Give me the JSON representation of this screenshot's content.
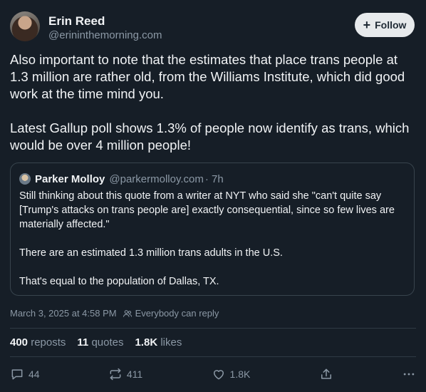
{
  "author": {
    "name": "Erin Reed",
    "handle": "@erininthemorning.com",
    "follow_label": "Follow"
  },
  "post": {
    "paragraphs": [
      "Also important to note that the estimates that place trans people at 1.3 million are rather old, from the Williams Institute, which did good work at the time mind you.",
      "Latest Gallup poll shows 1.3% of people now identify as trans, which would be over 4 million people!"
    ]
  },
  "quote": {
    "name": "Parker Molloy",
    "handle": "@parkermolloy.com",
    "time": "· 7h",
    "paragraphs": [
      "Still thinking about this quote from a writer at NYT who said she \"can't quite say [Trump's attacks on trans people are] exactly consequential, since so few lives are materially affected.\"",
      "There are an estimated 1.3 million trans adults in the U.S.",
      "That's equal to the population of Dallas, TX."
    ]
  },
  "meta": {
    "timestamp": "March 3, 2025 at 4:58 PM",
    "reply_setting": "Everybody can reply"
  },
  "stats": {
    "reposts_count": "400",
    "reposts_label": "reposts",
    "quotes_count": "11",
    "quotes_label": "quotes",
    "likes_count": "1.8K",
    "likes_label": "likes"
  },
  "actions": {
    "replies": "44",
    "reposts": "411",
    "likes": "1.8K"
  }
}
